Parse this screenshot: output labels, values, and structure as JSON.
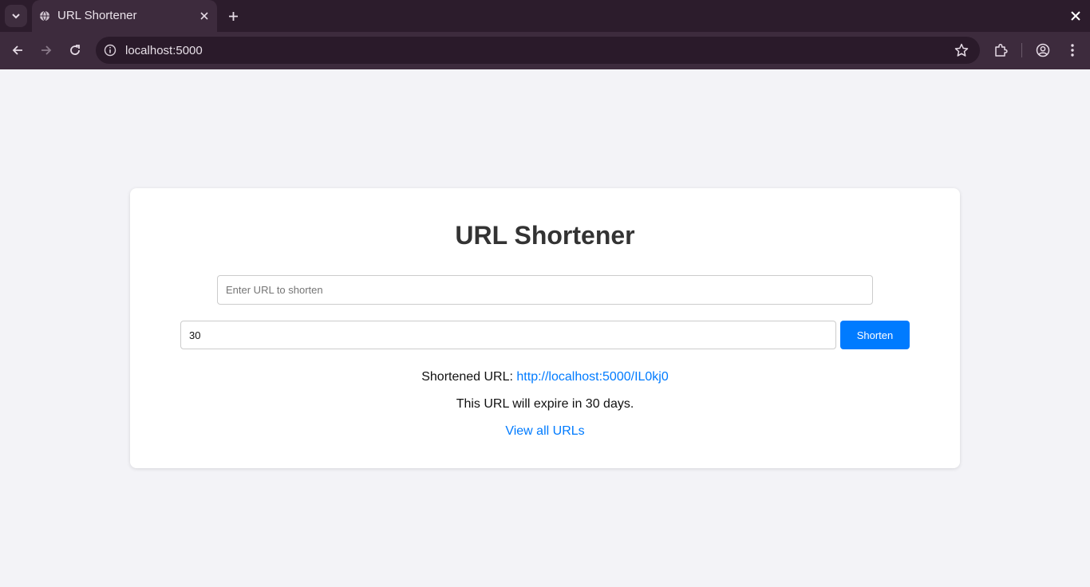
{
  "browser": {
    "tab_title": "URL Shortener",
    "address": "localhost:5000"
  },
  "page": {
    "title": "URL Shortener",
    "url_input": {
      "placeholder": "Enter URL to shorten",
      "value": ""
    },
    "days_input": {
      "value": "30"
    },
    "shorten_label": "Shorten",
    "result_label": "Shortened URL:",
    "short_url": "http://localhost:5000/IL0kj0",
    "expiry_text": "This URL will expire in 30 days.",
    "view_all_label": "View all URLs"
  },
  "colors": {
    "accent": "#007bff",
    "chrome_dark": "#2c1c2c",
    "chrome_toolbar": "#3d2b3d",
    "page_bg": "#f3f3f7"
  }
}
